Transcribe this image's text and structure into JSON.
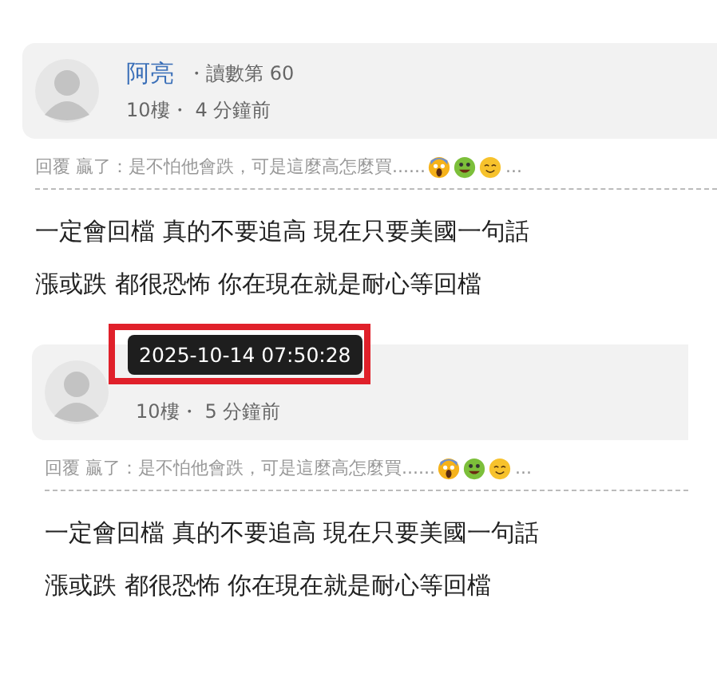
{
  "posts": [
    {
      "author": "阿亮",
      "read_count": "・讀數第 60",
      "floor": "10樓・",
      "time": "4 分鐘前",
      "reply": "回覆 贏了：是不怕他會跌，可是這麼高怎麼買......",
      "reply_tail": "...",
      "content_lines": [
        "一定會回檔 真的不要追高 現在只要美國一句話",
        "漲或跌 都很恐怖 你在現在就是耐心等回檔"
      ]
    },
    {
      "tooltip": {
        "text": "2025-10-14 07:50:28",
        "highlighted": true
      },
      "floor": "10樓・",
      "time": "5 分鐘前",
      "reply": "回覆 贏了：是不怕他會跌，可是這麼高怎麼買......",
      "reply_tail": "...",
      "content_lines": [
        "一定會回檔 真的不要追高 現在只要美國一句話",
        "漲或跌 都很恐怖 你在現在就是耐心等回檔"
      ]
    }
  ]
}
